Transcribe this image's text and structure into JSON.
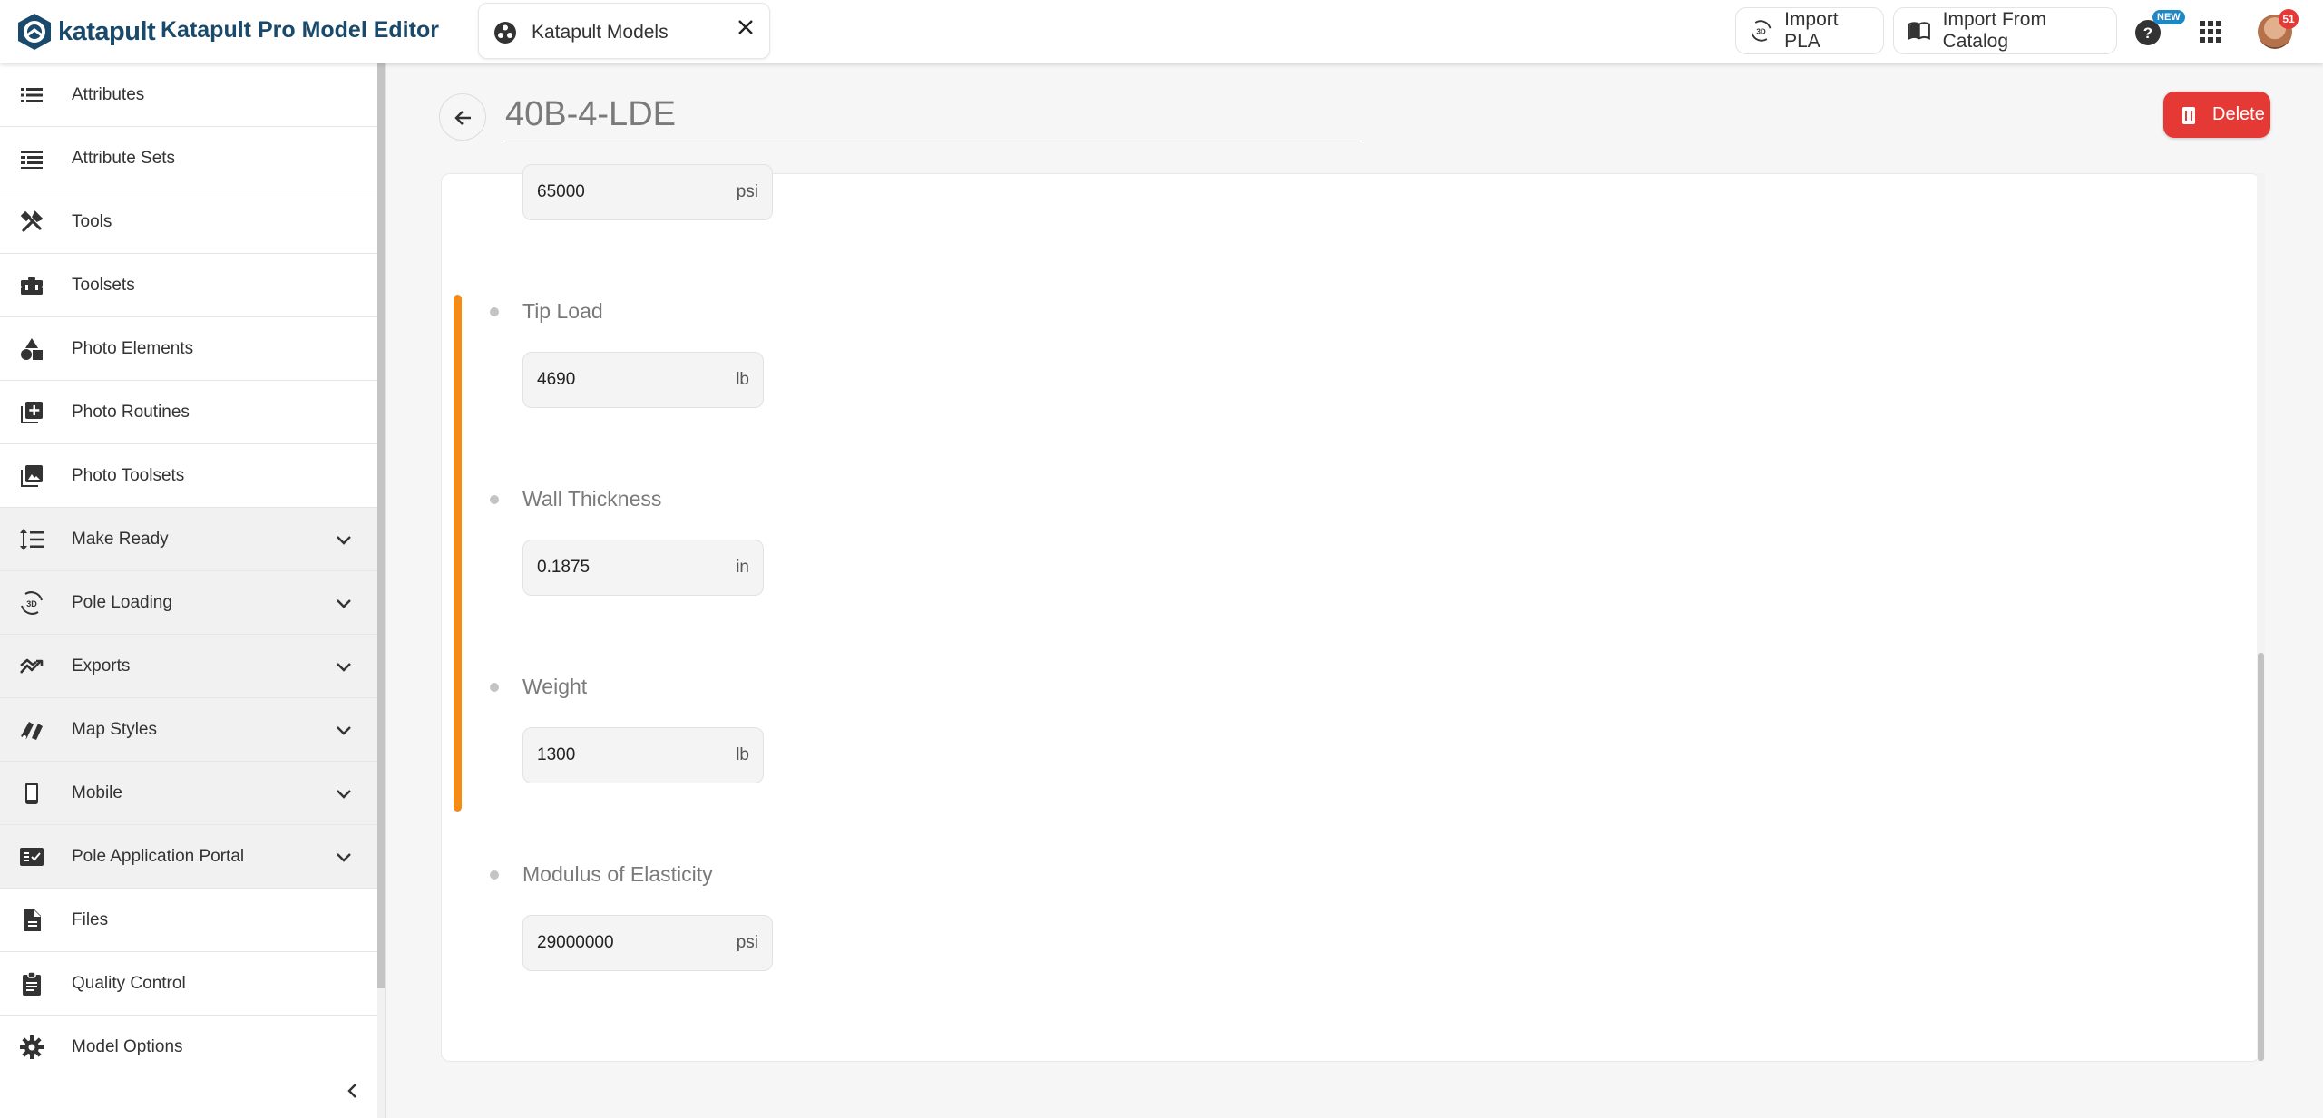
{
  "header": {
    "logo_text": "katapult",
    "app_title": "Katapult Pro Model Editor",
    "model_tab": {
      "label": "Katapult Models",
      "icon": "katapult-models-icon",
      "close_icon": "close-icon"
    },
    "import_pla_label": "Import PLA",
    "import_catalog_label": "Import From Catalog",
    "new_badge": "NEW",
    "notifications_count": "51"
  },
  "sidebar": {
    "items": [
      {
        "label": "Attributes",
        "icon": "list-icon",
        "expandable": false
      },
      {
        "label": "Attribute Sets",
        "icon": "table-rows-icon",
        "expandable": false
      },
      {
        "label": "Tools",
        "icon": "tools-icon",
        "expandable": false
      },
      {
        "label": "Toolsets",
        "icon": "toolbox-icon",
        "expandable": false
      },
      {
        "label": "Photo Elements",
        "icon": "shapes-icon",
        "expandable": false
      },
      {
        "label": "Photo Routines",
        "icon": "add-box-icon",
        "expandable": false
      },
      {
        "label": "Photo Toolsets",
        "icon": "photo-library-icon",
        "expandable": false
      },
      {
        "label": "Make Ready",
        "icon": "format-line-spacing-icon",
        "expandable": true
      },
      {
        "label": "Pole Loading",
        "icon": "3d-rotation-icon",
        "expandable": true
      },
      {
        "label": "Exports",
        "icon": "trending-icon",
        "expandable": true
      },
      {
        "label": "Map Styles",
        "icon": "map-styles-icon",
        "expandable": true
      },
      {
        "label": "Mobile",
        "icon": "phone-icon",
        "expandable": true
      },
      {
        "label": "Pole Application Portal",
        "icon": "fact-check-icon",
        "expandable": true
      },
      {
        "label": "Files",
        "icon": "file-icon",
        "expandable": false
      },
      {
        "label": "Quality Control",
        "icon": "clipboard-icon",
        "expandable": false
      },
      {
        "label": "Model Options",
        "icon": "gear-icon",
        "expandable": false
      }
    ]
  },
  "main": {
    "title": "40B-4-LDE",
    "delete_label": "Delete",
    "top_field": {
      "value": "65000",
      "unit": "psi"
    },
    "fields": [
      {
        "label": "Tip Load",
        "value": "4690",
        "unit": "lb"
      },
      {
        "label": "Wall Thickness",
        "value": "0.1875",
        "unit": "in"
      },
      {
        "label": "Weight",
        "value": "1300",
        "unit": "lb"
      },
      {
        "label": "Modulus of Elasticity",
        "value": "29000000",
        "unit": "psi"
      }
    ]
  },
  "colors": {
    "brand": "#1a4a6b",
    "accent_orange": "#f58a14",
    "delete_red": "#e53935",
    "new_badge": "#1e88c7"
  }
}
